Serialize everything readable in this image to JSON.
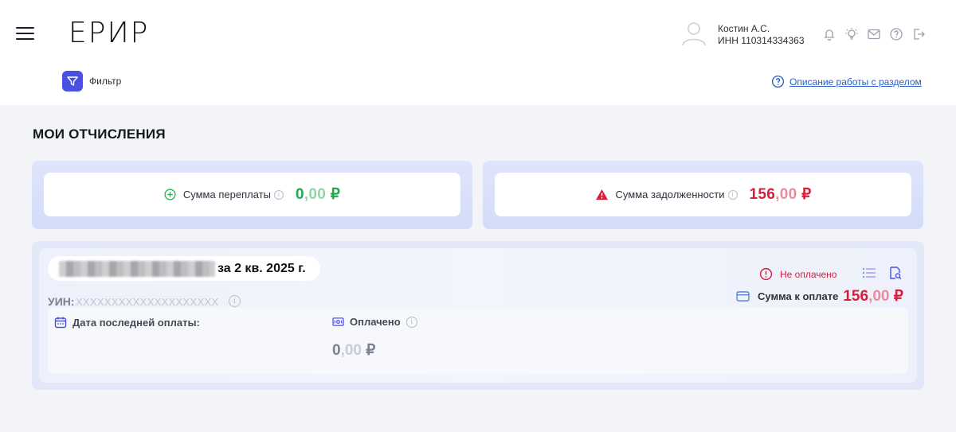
{
  "header": {
    "logo": "ЕРИР",
    "user_name": "Костин А.С.",
    "user_inn": "ИНН 110314334363",
    "icons": [
      "bell-icon",
      "lightbulb-icon",
      "mail-icon",
      "question-icon",
      "logout-icon"
    ]
  },
  "toolbar": {
    "filter_label": "Фильтр",
    "help_link": "Описание работы с разделом"
  },
  "page": {
    "title": "МОИ ОТЧИСЛЕНИЯ"
  },
  "summary": {
    "overpayment_label": "Сумма переплаты",
    "overpayment_int": "0",
    "overpayment_cents": ",00",
    "overpayment_currency": "₽",
    "debt_label": "Сумма задолженности",
    "debt_int": "156",
    "debt_cents": ",00",
    "debt_currency": "₽",
    "info_glyph": "i"
  },
  "accrual": {
    "period": "за 2 кв. 2025 г.",
    "uin_label": "УИН:",
    "uin_value": "XXXXXXXXXXXXXXXXXXXX",
    "status": "Не оплачено",
    "pay_label": "Сумма к оплате",
    "pay_int": "156",
    "pay_cents": ",00",
    "pay_currency": "₽",
    "last_payment_label": "Дата последней оплаты:",
    "paid_label": "Оплачено",
    "paid_int": "0",
    "paid_cents": ",00",
    "paid_currency": "₽"
  },
  "colors": {
    "accent": "#4a50e2",
    "positive": "#1faa4f",
    "negative": "#d4203d",
    "link": "#2960c6"
  }
}
